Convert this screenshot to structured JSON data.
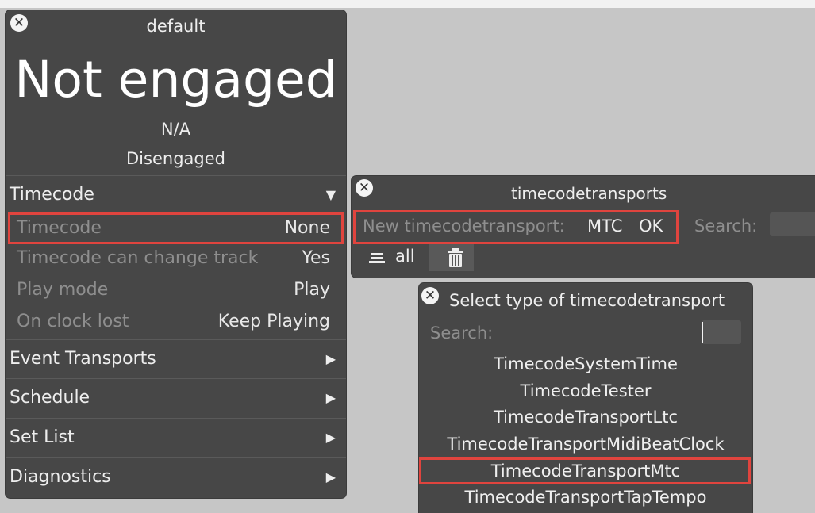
{
  "inspector": {
    "title": "default",
    "status_big": "Not engaged",
    "status_na": "N/A",
    "status_engage": "Disengaged",
    "sections": [
      {
        "label": "Timecode",
        "arrow": "▼"
      },
      {
        "label": "Event Transports",
        "arrow": "▶"
      },
      {
        "label": "Schedule",
        "arrow": "▶"
      },
      {
        "label": "Set List",
        "arrow": "▶"
      },
      {
        "label": "Diagnostics",
        "arrow": "▶"
      }
    ],
    "properties": [
      {
        "key": "Timecode",
        "value": "None"
      },
      {
        "key": "Timecode can change track",
        "value": "Yes"
      },
      {
        "key": "Play mode",
        "value": "Play"
      },
      {
        "key": "On clock lost",
        "value": "Keep Playing"
      }
    ]
  },
  "transports": {
    "title": "timecodetransports",
    "new_label": "New timecodetransport:",
    "new_value": "MTC",
    "ok_label": "OK",
    "search_label": "Search:",
    "all_label": "all"
  },
  "select_type": {
    "title": "Select type of timecodetransport",
    "search_label": "Search:",
    "items": [
      "TimecodeSystemTime",
      "TimecodeTester",
      "TimecodeTransportLtc",
      "TimecodeTransportMidiBeatClock",
      "TimecodeTransportMtc",
      "TimecodeTransportTapTempo"
    ]
  },
  "colors": {
    "panel": "#474747",
    "highlight": "#e0443e",
    "background": "#c6c6c6"
  }
}
